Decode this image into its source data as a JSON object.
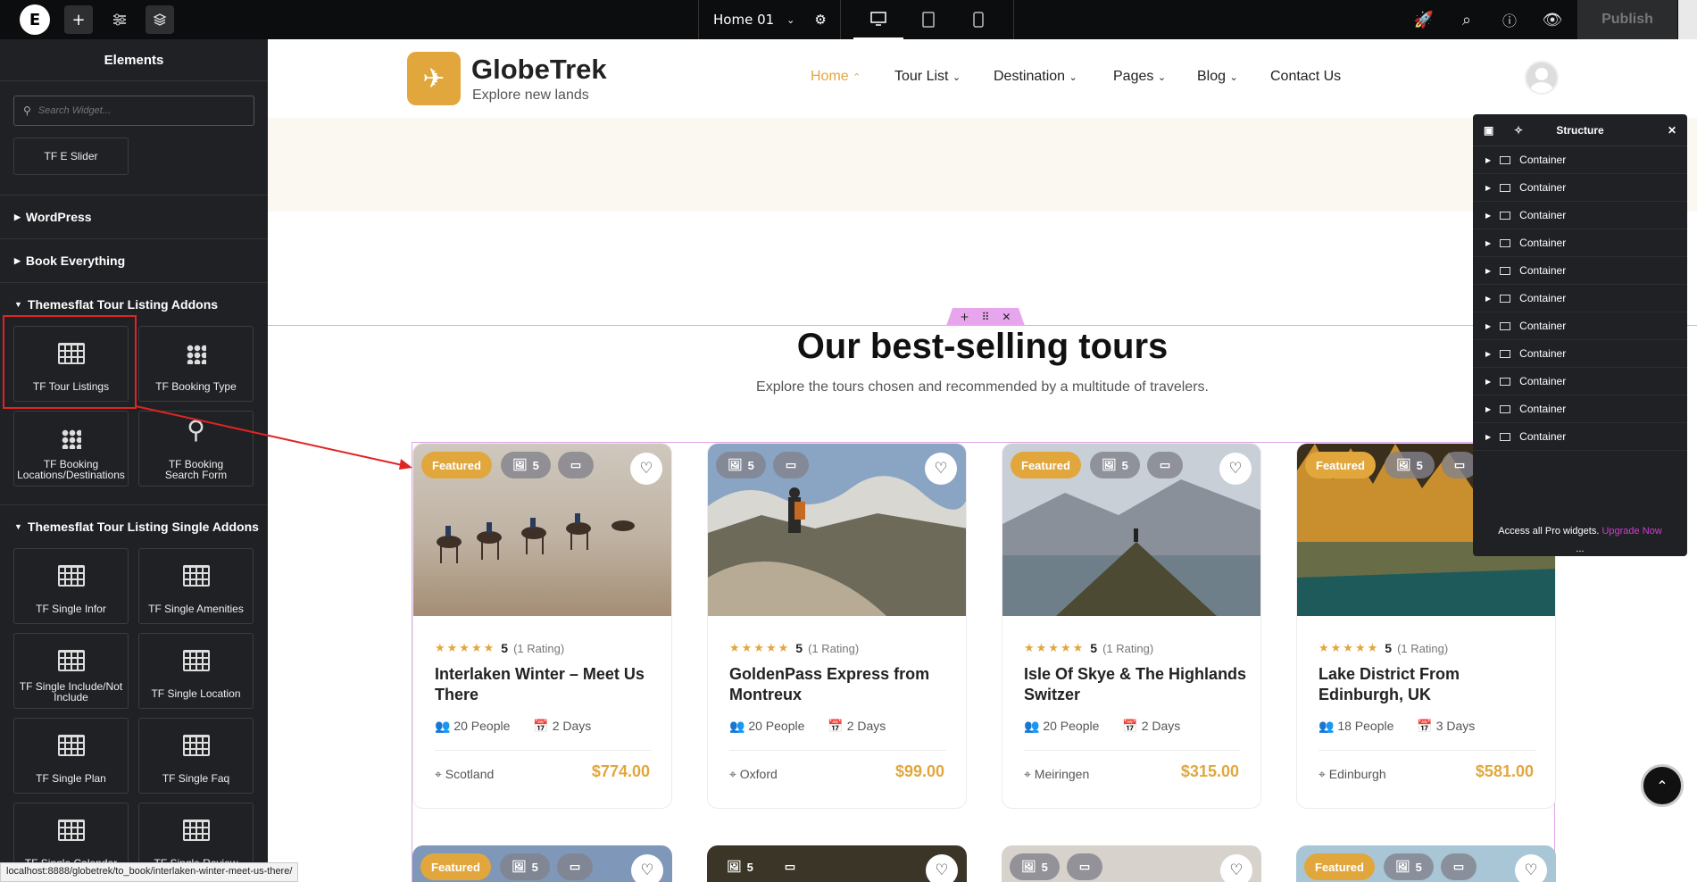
{
  "topbar": {
    "document_name": "Home 01",
    "publish_label": "Publish"
  },
  "sidebar": {
    "title": "Elements",
    "search_placeholder": "Search Widget...",
    "top_widget": "TF E Slider",
    "sections": {
      "wordpress": "WordPress",
      "book_everything": "Book Everything",
      "tour_addons": "Themesflat Tour Listing Addons",
      "single_addons": "Themesflat Tour Listing Single Addons"
    },
    "tour_widgets": [
      "TF Tour Listings",
      "TF Booking Type",
      "TF Booking Locations/Destinations",
      "TF Booking Search Form"
    ],
    "single_widgets": [
      "TF Single Infor",
      "TF Single Amenities",
      "TF Single Include/Not Include",
      "TF Single Location",
      "TF Single Plan",
      "TF Single Faq",
      "TF Single Calendar",
      "TF Single Review"
    ]
  },
  "site": {
    "brand": "GlobeTrek",
    "tagline": "Explore new lands",
    "nav": [
      "Home",
      "Tour List",
      "Destination",
      "Pages",
      "Blog",
      "Contact Us"
    ],
    "section_title": "Our best-selling tours",
    "section_subtitle": "Explore the tours chosen and recommended by a multitude of travelers."
  },
  "cards": [
    {
      "featured": "Featured",
      "gallery": "5",
      "rating": "5",
      "rating_count": "(1 Rating)",
      "title": "Interlaken Winter – Meet Us There",
      "people": "20 People",
      "days": "2 Days",
      "location": "Scotland",
      "price": "$774.00"
    },
    {
      "featured": "",
      "gallery": "5",
      "rating": "5",
      "rating_count": "(1 Rating)",
      "title": "GoldenPass Express from Montreux",
      "people": "20 People",
      "days": "2 Days",
      "location": "Oxford",
      "price": "$99.00"
    },
    {
      "featured": "Featured",
      "gallery": "5",
      "rating": "5",
      "rating_count": "(1 Rating)",
      "title": "Isle Of Skye & The Highlands Switzer",
      "people": "20 People",
      "days": "2 Days",
      "location": "Meiringen",
      "price": "$315.00"
    },
    {
      "featured": "Featured",
      "gallery": "5",
      "rating": "5",
      "rating_count": "(1 Rating)",
      "title": "Lake District From Edinburgh, UK",
      "people": "18 People",
      "days": "3 Days",
      "location": "Edinburgh",
      "price": "$581.00"
    }
  ],
  "cards_row2": [
    {
      "featured": "Featured",
      "gallery": "5"
    },
    {
      "featured": "",
      "gallery": "5"
    },
    {
      "featured": "",
      "gallery": "5"
    },
    {
      "featured": "Featured",
      "gallery": "5"
    }
  ],
  "structure": {
    "title": "Structure",
    "items": [
      "Container",
      "Container",
      "Container",
      "Container",
      "Container",
      "Container",
      "Container",
      "Container",
      "Container",
      "Container",
      "Container"
    ],
    "pro_text": "Access all Pro widgets.",
    "upgrade_label": "Upgrade Now",
    "more": "..."
  },
  "status_url": "localhost:8888/globetrek/to_book/interlaken-winter-meet-us-there/",
  "colors": {
    "accent": "#e1a73d",
    "editor_dark": "#1f2124",
    "pink": "#e0a5e6",
    "highlight_red": "#e02424"
  }
}
